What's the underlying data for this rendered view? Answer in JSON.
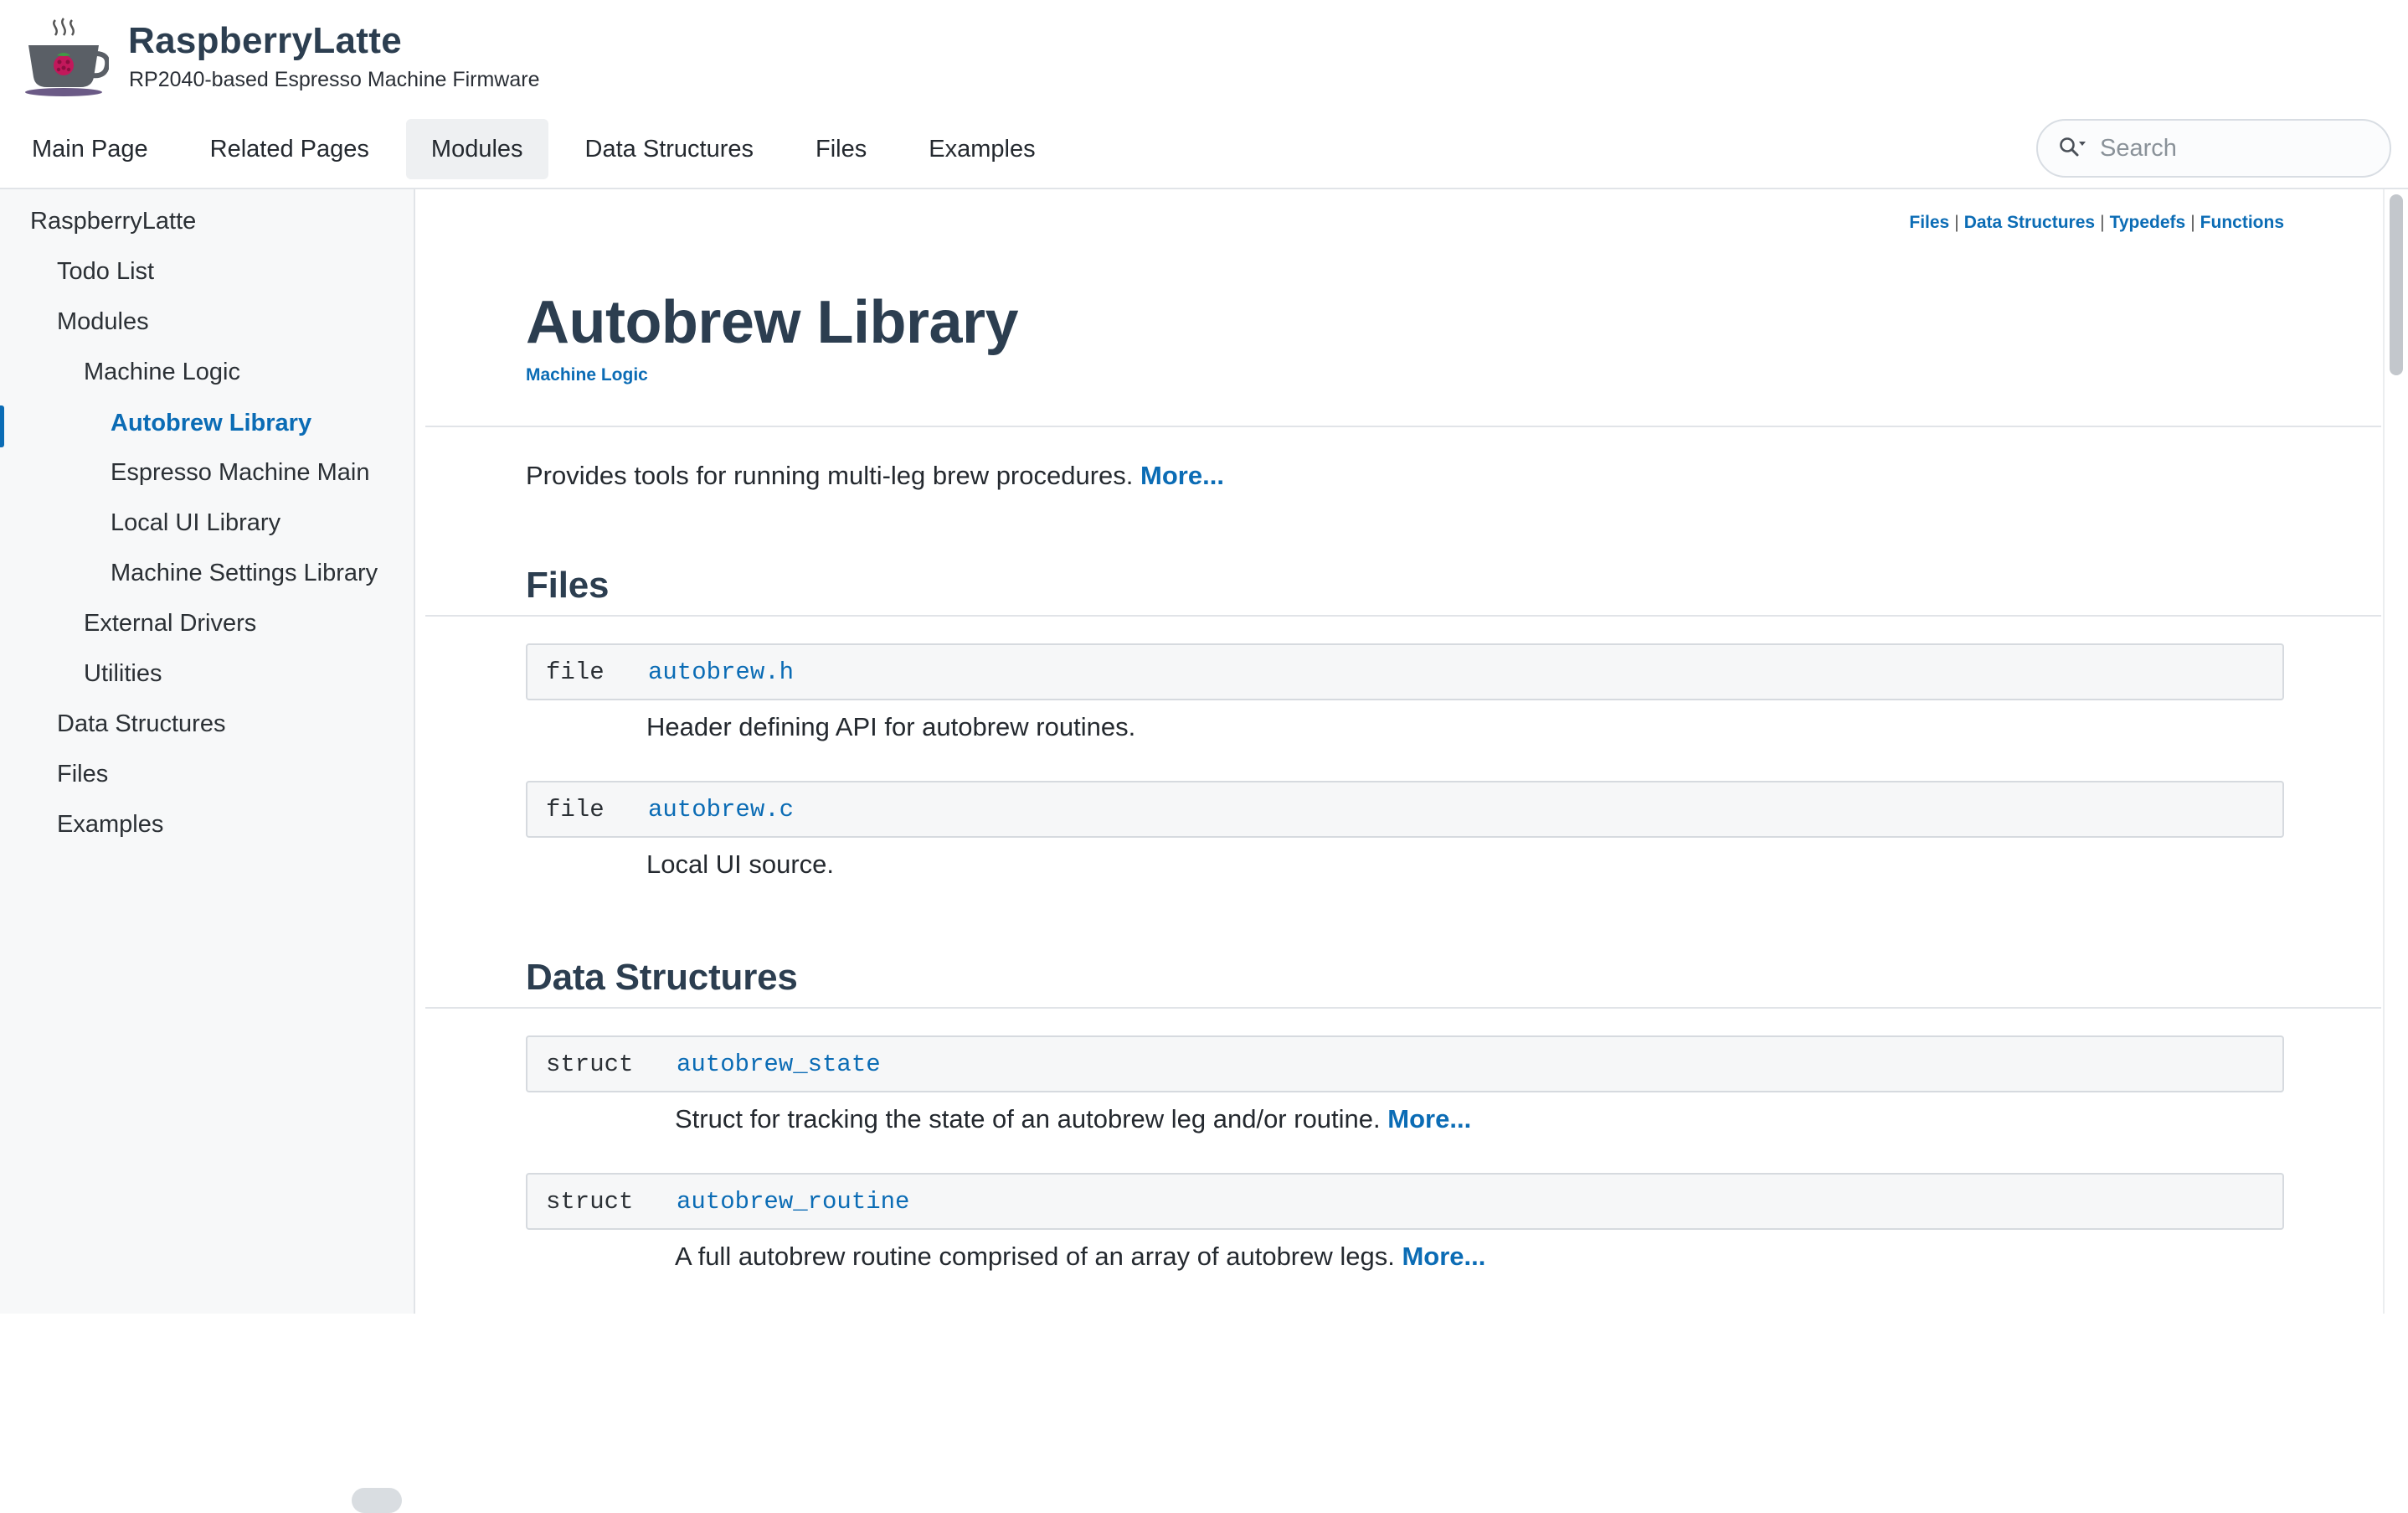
{
  "project": {
    "name": "RaspberryLatte",
    "brief": "RP2040-based Espresso Machine Firmware",
    "logo_icon": "coffee-cup-raspberry-icon"
  },
  "nav": {
    "items": [
      {
        "label": "Main Page"
      },
      {
        "label": "Related Pages"
      },
      {
        "label": "Modules",
        "active": true
      },
      {
        "label": "Data Structures"
      },
      {
        "label": "Files"
      },
      {
        "label": "Examples"
      }
    ]
  },
  "search": {
    "placeholder": "Search",
    "icon": "search-icon"
  },
  "sidebar": {
    "items": [
      {
        "label": "RaspberryLatte"
      },
      {
        "label": "Todo List"
      },
      {
        "label": "Modules"
      },
      {
        "label": "Machine Logic"
      },
      {
        "label": "Autobrew Library",
        "selected": true
      },
      {
        "label": "Espresso Machine Main"
      },
      {
        "label": "Local UI Library"
      },
      {
        "label": "Machine Settings Library"
      },
      {
        "label": "External Drivers"
      },
      {
        "label": "Utilities"
      },
      {
        "label": "Data Structures"
      },
      {
        "label": "Files"
      },
      {
        "label": "Examples"
      }
    ]
  },
  "summary_links": {
    "files": "Files",
    "data_structures": "Data Structures",
    "typedefs": "Typedefs",
    "functions": "Functions",
    "separator": "|"
  },
  "page": {
    "title": "Autobrew Library",
    "ingroup": "Machine Logic",
    "brief": "Provides tools for running multi-leg brew procedures.",
    "more": "More..."
  },
  "sections": {
    "files": {
      "heading": "Files",
      "members": [
        {
          "kind": "file",
          "name": "autobrew.h",
          "desc": "Header defining API for autobrew routines."
        },
        {
          "kind": "file",
          "name": "autobrew.c",
          "desc": "Local UI source."
        }
      ]
    },
    "data_structures": {
      "heading": "Data Structures",
      "members": [
        {
          "kind": "struct",
          "name": "autobrew_state",
          "desc": "Struct for tracking the state of an autobrew leg and/or routine.",
          "more": "More..."
        },
        {
          "kind": "struct",
          "name": "autobrew_routine",
          "desc": "A full autobrew routine comprised of an array of autobrew legs.",
          "more": "More..."
        }
      ]
    }
  },
  "colors": {
    "link": "#0b6cb5",
    "heading": "#2c3e50",
    "nav_active_bg": "#eef0f2",
    "sidebar_bg": "#f7f8f9",
    "member_bg": "#f6f7f8"
  }
}
